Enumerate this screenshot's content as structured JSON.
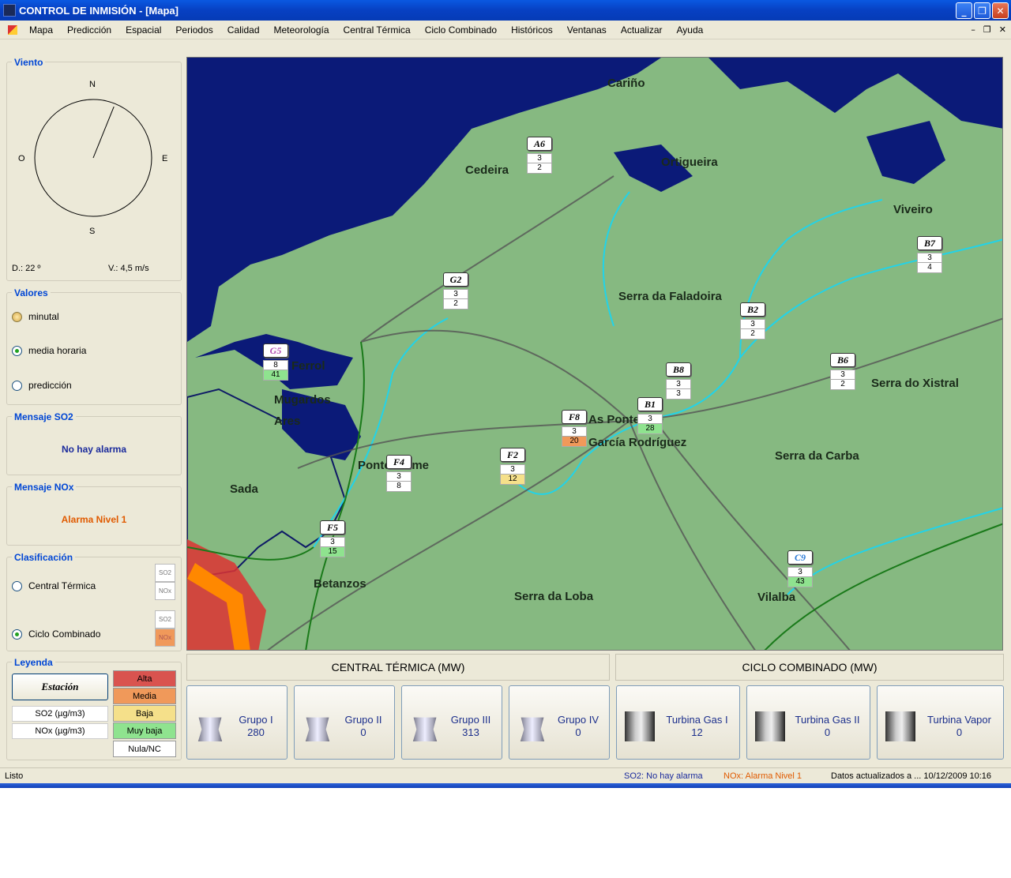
{
  "window": {
    "title": "CONTROL DE INMISIÓN - [Mapa]",
    "btn_min": "_",
    "btn_max": "❐",
    "btn_close": "✕"
  },
  "menu": [
    "Mapa",
    "Predicción",
    "Espacial",
    "Periodos",
    "Calidad",
    "Meteorología",
    "Central Térmica",
    "Ciclo Combinado",
    "Históricos",
    "Ventanas",
    "Actualizar",
    "Ayuda"
  ],
  "mdi": {
    "min": "–",
    "restore": "❐",
    "close": "✕"
  },
  "viento": {
    "label": "Viento",
    "n": "N",
    "s": "S",
    "e": "E",
    "o": "O",
    "direccion": "D.:  22 º",
    "velocidad": "V.: 4,5 m/s",
    "direction_deg": 22
  },
  "valores": {
    "label": "Valores",
    "options": [
      "minutal",
      "media horaria",
      "predicción"
    ],
    "selected": "media horaria"
  },
  "mensaje_so2": {
    "label": "Mensaje SO2",
    "text": "No hay alarma",
    "color": "#1a2a9c"
  },
  "mensaje_nox": {
    "label": "Mensaje NOx",
    "text": "Alarma Nivel 1",
    "color": "#e05a00"
  },
  "clasificacion": {
    "label": "Clasificación",
    "options": [
      "Central Térmica",
      "Ciclo Combinado"
    ],
    "selected": "Ciclo Combinado",
    "so2": "SO2",
    "nox": "NOx"
  },
  "leyenda": {
    "label": "Leyenda",
    "estacion": "Estación",
    "so2_unit": "SO2 (µg/m3)",
    "nox_unit": "NOx (µg/m3)",
    "levels": [
      {
        "name": "Alta",
        "color": "#d9534f"
      },
      {
        "name": "Media",
        "color": "#f0995a"
      },
      {
        "name": "Baja",
        "color": "#f5e08a"
      },
      {
        "name": "Muy baja",
        "color": "#8fe38f"
      },
      {
        "name": "Nula/NC",
        "color": "#ffffff"
      }
    ]
  },
  "map": {
    "towns": [
      "Cariño",
      "Cedeira",
      "Ortigueira",
      "Viveiro",
      "Serra da Faladoira",
      "Serra do Xistral",
      "Ferrol",
      "Mugardos",
      "Ares",
      "Pontedeume",
      "As Pontes de",
      "García Rodríguez",
      "Serra da Carba",
      "Sada",
      "Betanzos",
      "Serra da Loba",
      "Vilalba"
    ],
    "stations": [
      {
        "id": "A6",
        "so2": "3",
        "nox": "2",
        "nox_color": "#ffffff"
      },
      {
        "id": "G2",
        "so2": "3",
        "nox": "2",
        "nox_color": "#ffffff"
      },
      {
        "id": "G5",
        "so2": "8",
        "nox": "41",
        "nox_color": "#8fe38f",
        "highlight": "#b24bb2"
      },
      {
        "id": "B7",
        "so2": "3",
        "nox": "4",
        "nox_color": "#ffffff"
      },
      {
        "id": "B2",
        "so2": "3",
        "nox": "2",
        "nox_color": "#ffffff"
      },
      {
        "id": "B8",
        "so2": "3",
        "nox": "3",
        "nox_color": "#ffffff"
      },
      {
        "id": "B6",
        "so2": "3",
        "nox": "2",
        "nox_color": "#ffffff"
      },
      {
        "id": "B1",
        "so2": "3",
        "nox": "28",
        "nox_color": "#8fe38f"
      },
      {
        "id": "F8",
        "so2": "3",
        "nox": "20",
        "nox_color": "#f0995a"
      },
      {
        "id": "F2",
        "so2": "3",
        "nox": "12",
        "nox_color": "#f5e08a"
      },
      {
        "id": "F4",
        "so2": "3",
        "nox": "8",
        "nox_color": "#ffffff"
      },
      {
        "id": "F5",
        "so2": "3",
        "nox": "15",
        "nox_color": "#8fe38f"
      },
      {
        "id": "C9",
        "so2": "3",
        "nox": "43",
        "nox_color": "#8fe38f",
        "highlight": "#2a7ad6"
      }
    ]
  },
  "central_termica": {
    "title": "CENTRAL TÉRMICA (MW)",
    "units": [
      {
        "name": "Grupo I",
        "mw": "280"
      },
      {
        "name": "Grupo II",
        "mw": "0"
      },
      {
        "name": "Grupo III",
        "mw": "313"
      },
      {
        "name": "Grupo IV",
        "mw": "0"
      }
    ]
  },
  "ciclo_combinado": {
    "title": "CICLO COMBINADO (MW)",
    "units": [
      {
        "name": "Turbina Gas I",
        "mw": "12"
      },
      {
        "name": "Turbina Gas II",
        "mw": "0"
      },
      {
        "name": "Turbina Vapor",
        "mw": "0"
      }
    ]
  },
  "status": {
    "ready": "Listo",
    "so2": "SO2: No hay alarma",
    "nox": "NOx: Alarma Nivel 1",
    "updated": "Datos actualizados a ... 10/12/2009  10:16"
  }
}
